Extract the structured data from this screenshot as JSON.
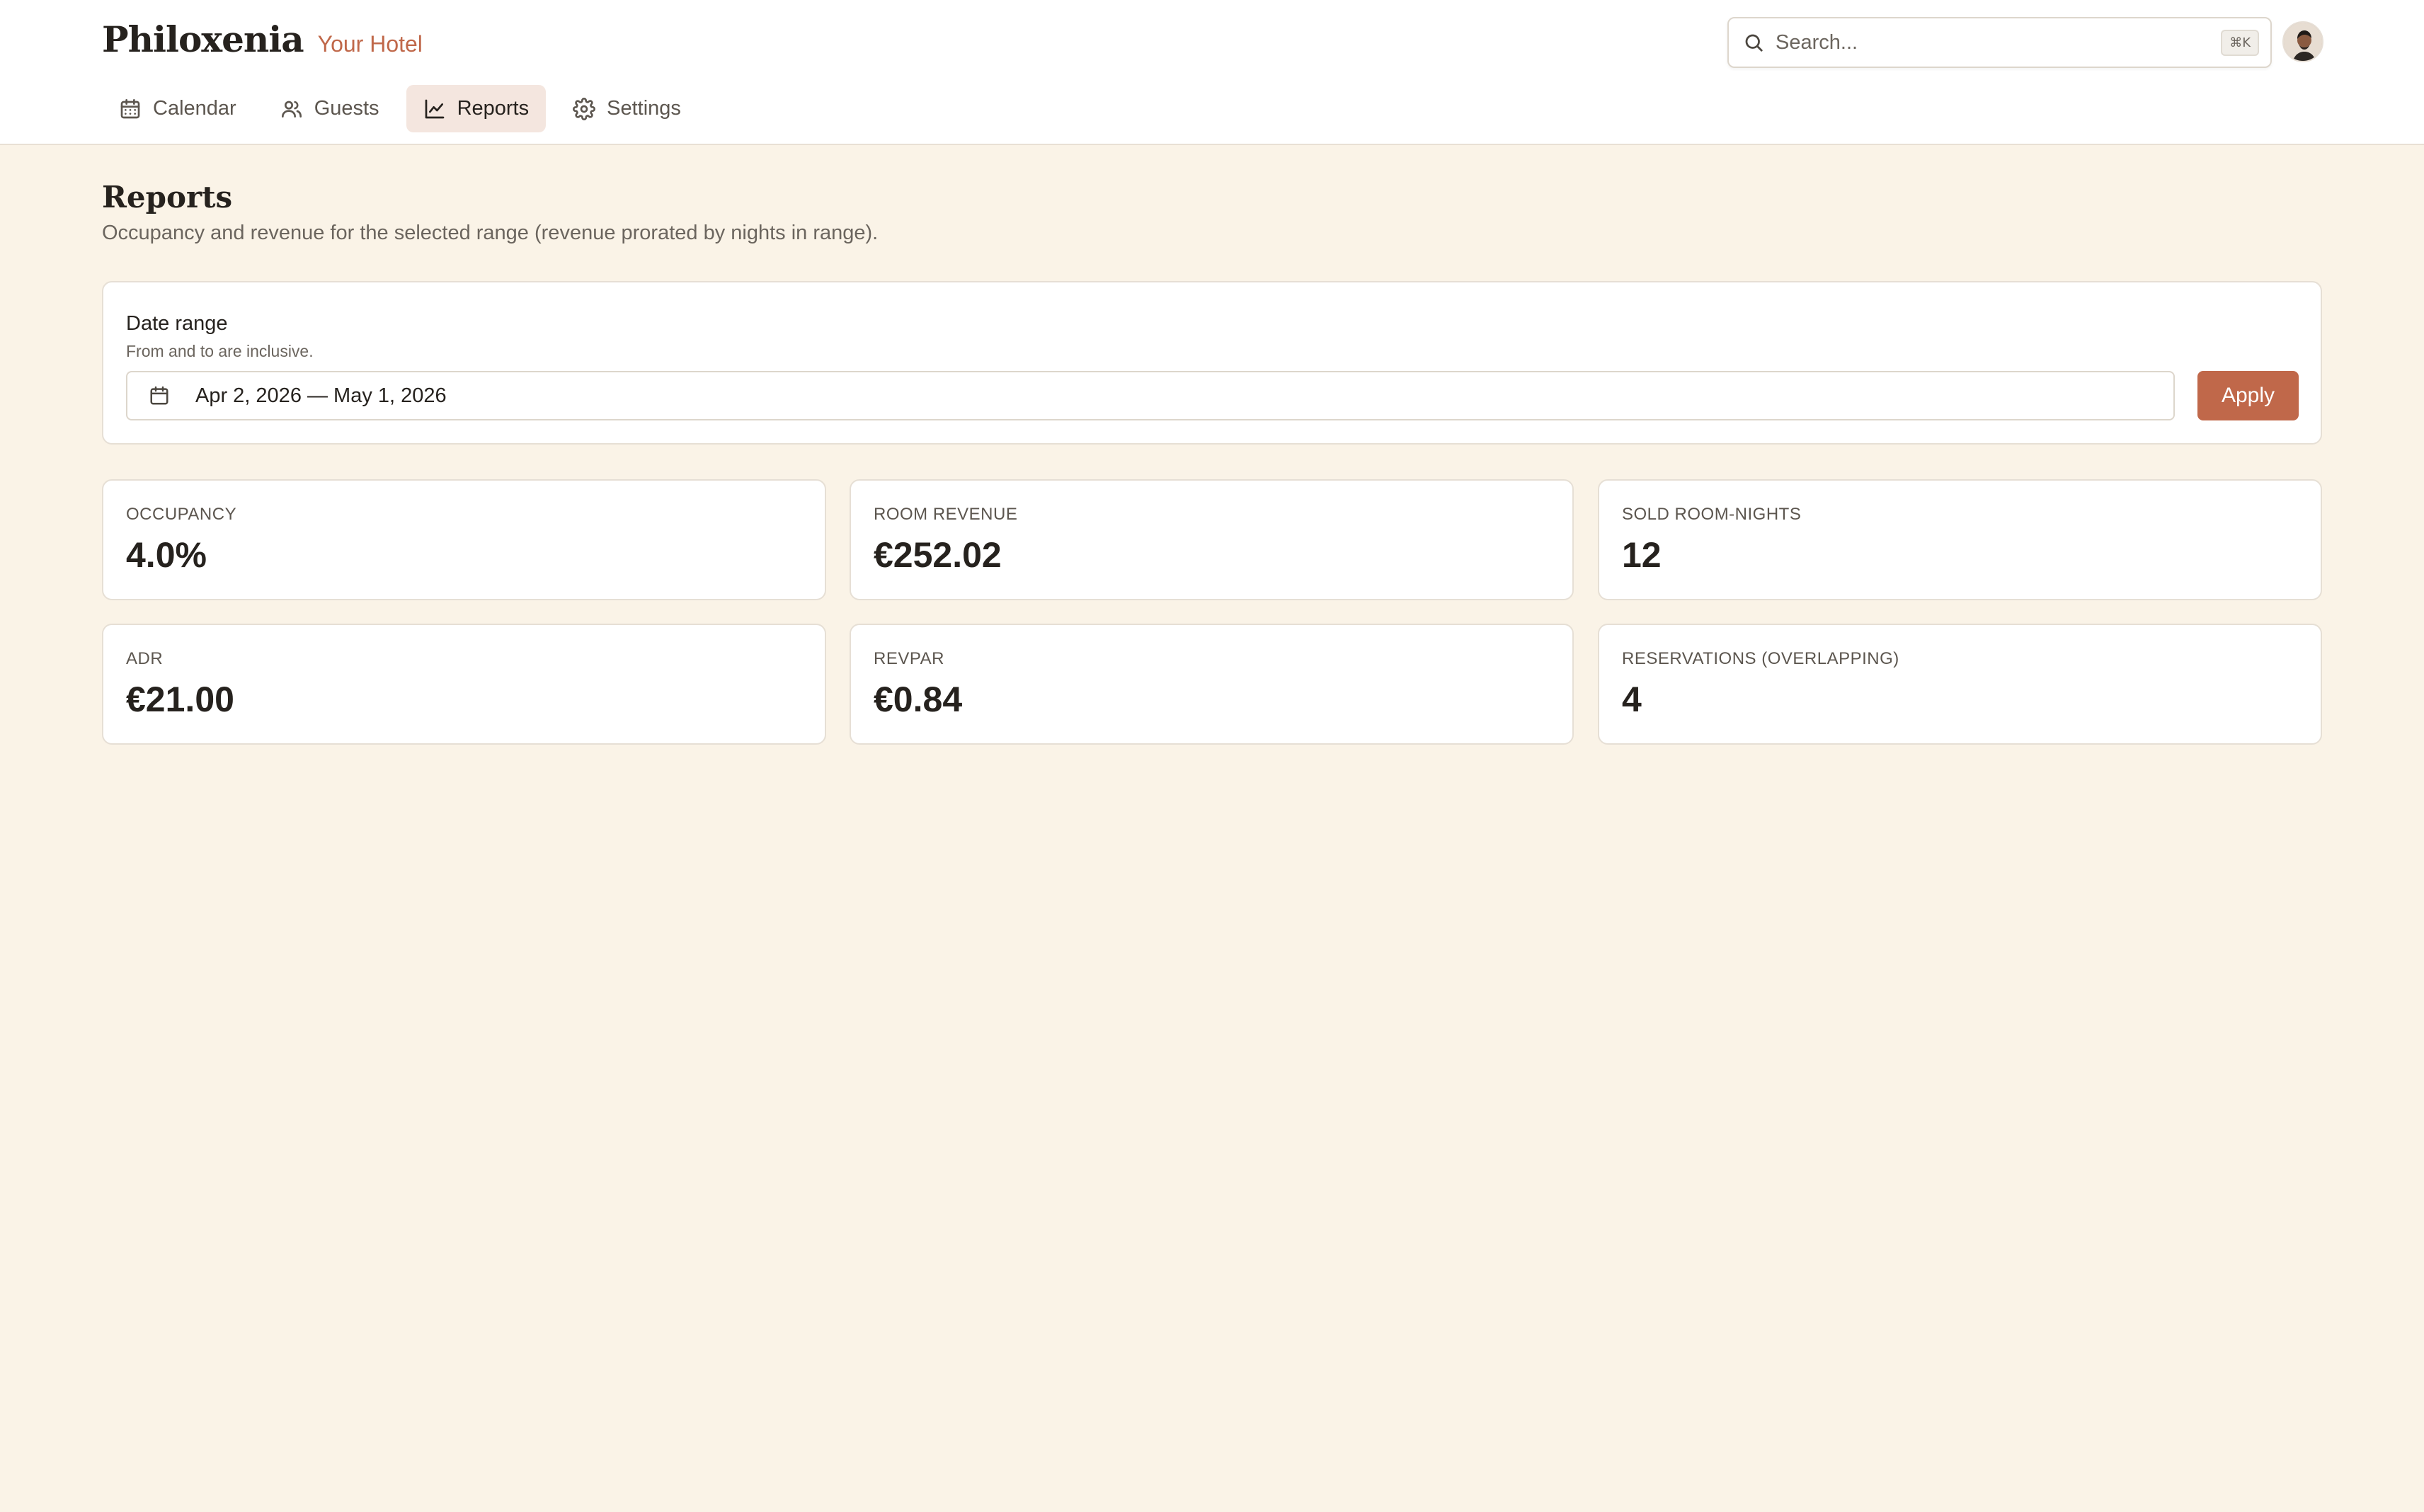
{
  "app": {
    "name": "Philoxenia",
    "hotel": "Your Hotel"
  },
  "nav": [
    {
      "label": "Calendar",
      "icon": "calendar-icon",
      "active": false
    },
    {
      "label": "Guests",
      "icon": "users-icon",
      "active": false
    },
    {
      "label": "Reports",
      "icon": "line-chart-icon",
      "active": true
    },
    {
      "label": "Settings",
      "icon": "gear-icon",
      "active": false
    }
  ],
  "search": {
    "placeholder": "Search...",
    "shortcut": "⌘K"
  },
  "page": {
    "title": "Reports",
    "description": "Occupancy and revenue for the selected range (revenue prorated by nights in range)."
  },
  "date_range": {
    "label": "Date range",
    "hint": "From and to are inclusive.",
    "value": "Apr 2, 2026 — May 1, 2026",
    "apply_label": "Apply"
  },
  "metrics": [
    {
      "label": "OCCUPANCY",
      "value": "4.0%"
    },
    {
      "label": "ROOM REVENUE",
      "value": "€252.02"
    },
    {
      "label": "SOLD ROOM-NIGHTS",
      "value": "12"
    },
    {
      "label": "ADR",
      "value": "€21.00"
    },
    {
      "label": "REVPAR",
      "value": "€0.84"
    },
    {
      "label": "RESERVATIONS (OVERLAPPING)",
      "value": "4"
    }
  ],
  "colors": {
    "accent": "#c0684a",
    "background": "#faf3e7",
    "active_tab": "#f4e6df"
  }
}
